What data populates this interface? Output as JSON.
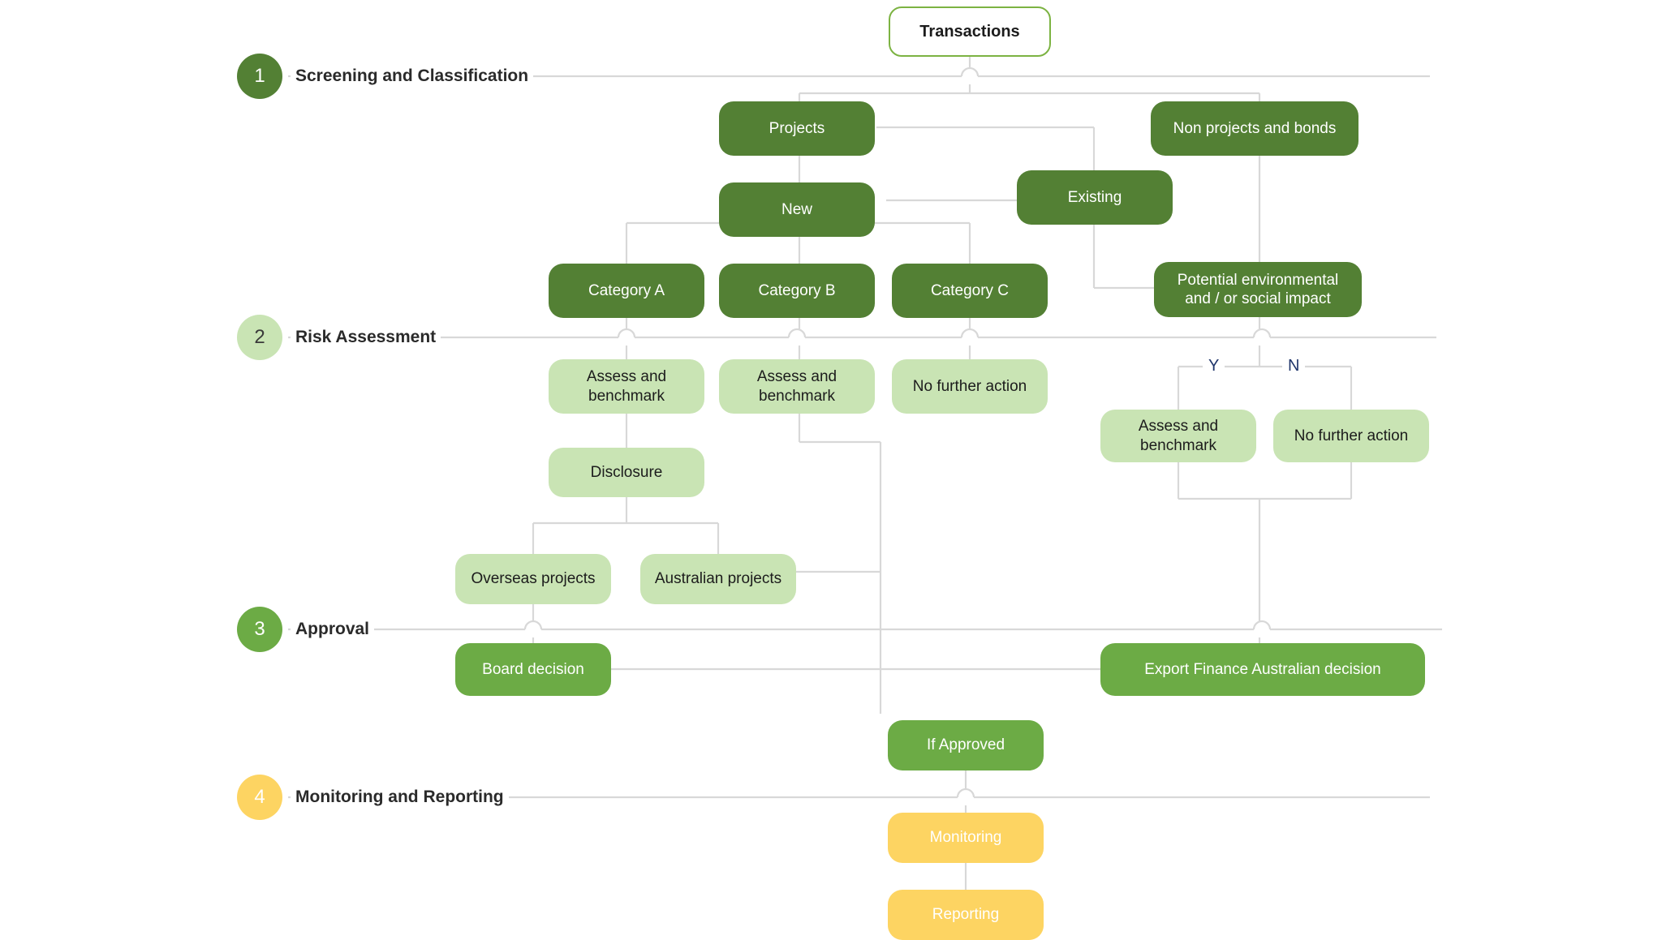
{
  "diagram": {
    "title_node": {
      "label": "Transactions"
    },
    "sections": [
      {
        "number": "1",
        "label": "Screening and Classification",
        "color": "#538034"
      },
      {
        "number": "2",
        "label": "Risk Assessment",
        "color": "#c9e4b4"
      },
      {
        "number": "3",
        "label": "Approval",
        "color": "#6cab45"
      },
      {
        "number": "4",
        "label": "Monitoring and Reporting",
        "color": "#fdd462"
      }
    ],
    "edge_labels": {
      "yes": "Y",
      "no": "N"
    },
    "nodes": {
      "projects": "Projects",
      "non_projects_bonds": "Non projects and bonds",
      "new": "New",
      "existing": "Existing",
      "category_a": "Category A",
      "category_b": "Category B",
      "category_c": "Category C",
      "potential_impact_line1": "Potential environmental",
      "potential_impact_line2": "and / or social impact",
      "assess_a_line1": "Assess and",
      "assess_a_line2": "benchmark",
      "assess_b_line1": "Assess and",
      "assess_b_line2": "benchmark",
      "no_further_action_c": "No further action",
      "assess_y_line1": "Assess and",
      "assess_y_line2": "benchmark",
      "no_further_action_n": "No further action",
      "disclosure": "Disclosure",
      "overseas_projects": "Overseas projects",
      "australian_projects": "Australian projects",
      "board_decision": "Board decision",
      "export_finance_decision": "Export Finance Australian decision",
      "if_approved": "If Approved",
      "monitoring": "Monitoring",
      "reporting": "Reporting"
    },
    "colors": {
      "dark_green": "#538034",
      "light_green": "#c9e4b4",
      "mid_green": "#6cab45",
      "yellow": "#fdd462",
      "root_border": "#7cb342",
      "connector": "#d6d6d6",
      "yn_text": "#20366b"
    }
  }
}
